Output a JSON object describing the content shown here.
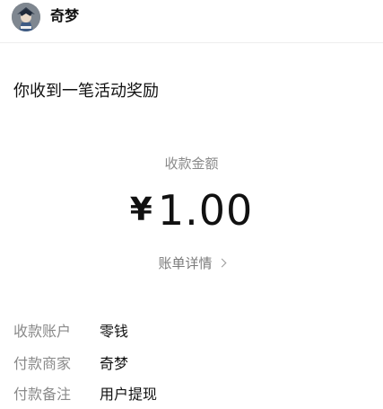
{
  "header": {
    "merchant_name": "奇梦",
    "avatar_icon": "anime-character-avatar-icon"
  },
  "notice": {
    "title": "你收到一笔活动奖励"
  },
  "amount": {
    "label": "收款金额",
    "currency": "¥",
    "value": "1.00"
  },
  "detail_link": {
    "label": "账单详情",
    "icon": "chevron-right-icon"
  },
  "info": {
    "rows": [
      {
        "key": "收款账户",
        "value": "零钱"
      },
      {
        "key": "付款商家",
        "value": "奇梦"
      },
      {
        "key": "付款备注",
        "value": "用户提现"
      }
    ]
  },
  "colors": {
    "primary_text": "#111111",
    "secondary_text": "#8a8a8a",
    "divider": "#eeeeee",
    "background": "#ffffff"
  }
}
